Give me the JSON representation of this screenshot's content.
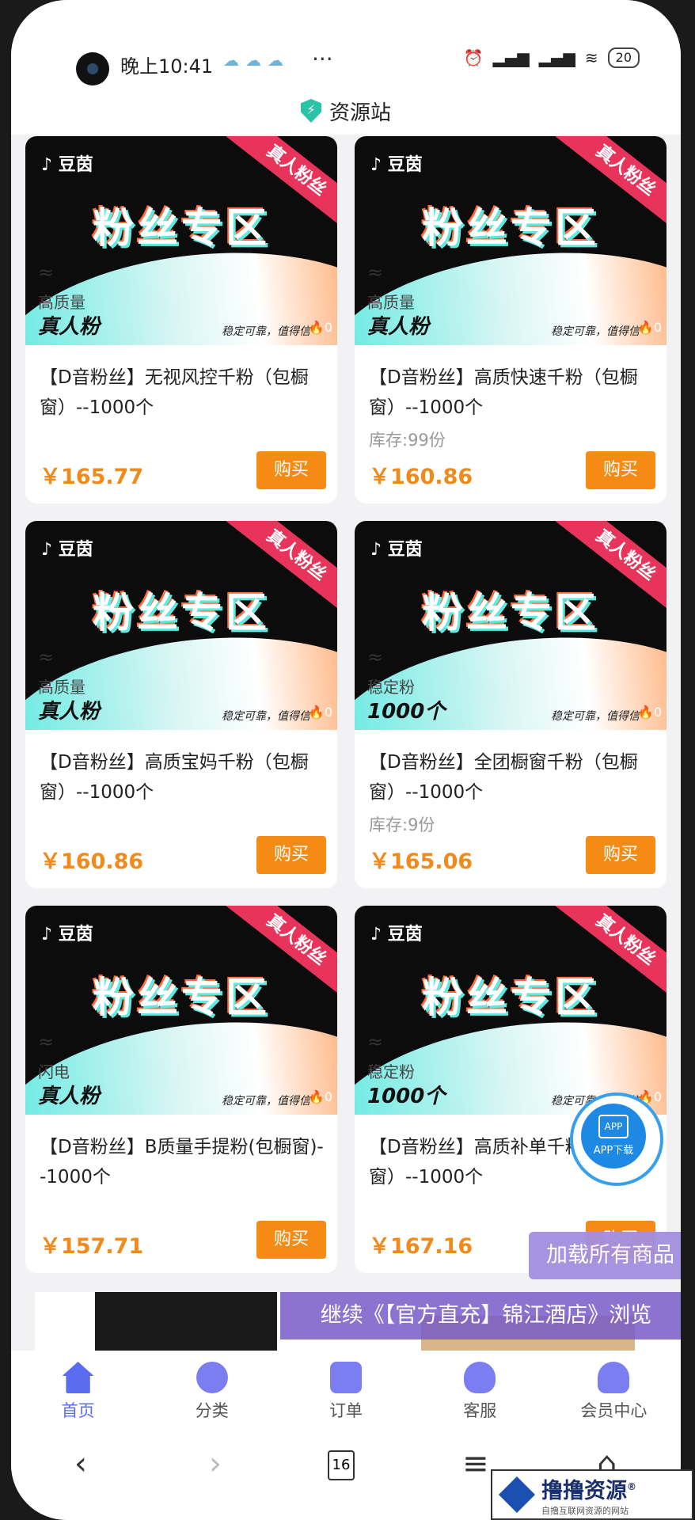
{
  "status_bar": {
    "time": "晚上10:41",
    "dots": "···",
    "battery": "20"
  },
  "header": {
    "title": "资源站",
    "shield_glyph": "⚡"
  },
  "card_common": {
    "brand": "♪ 豆茵",
    "ribbon": "真人粉丝",
    "headline": "粉丝专区",
    "wave_mark": "≈",
    "slogan": "稳定可靠，值得信",
    "fire": "🔥0",
    "buy_label": "购买"
  },
  "products": [
    {
      "subtag": "高质量",
      "main_tag": "真人粉",
      "name": "【D音粉丝】无视风控千粉（包橱窗）--1000个",
      "stock": "",
      "price": "￥165.77"
    },
    {
      "subtag": "高质量",
      "main_tag": "真人粉",
      "name": "【D音粉丝】高质快速千粉（包橱窗）--1000个",
      "stock": "库存:99份",
      "price": "￥160.86"
    },
    {
      "subtag": "高质量",
      "main_tag": "真人粉",
      "name": "【D音粉丝】高质宝妈千粉（包橱窗）--1000个",
      "stock": "",
      "price": "￥160.86"
    },
    {
      "subtag": "稳定粉",
      "main_tag": "1000个",
      "name": "【D音粉丝】全团橱窗千粉（包橱窗）--1000个",
      "stock": "库存:9份",
      "price": "￥165.06"
    },
    {
      "subtag": "闪电",
      "main_tag": "真人粉",
      "name": "【D音粉丝】B质量手提粉(包橱窗)--1000个",
      "stock": "",
      "price": "￥157.71"
    },
    {
      "subtag": "稳定粉",
      "main_tag": "1000个",
      "name": "【D音粉丝】高质补单千粉（包橱窗）--1000个",
      "stock": "",
      "price": "￥167.16"
    }
  ],
  "floating": {
    "app_icon": "APP",
    "app_label": "APP下载",
    "load_all": "加载所有商品",
    "continue": "继续《【官方直充】锦江酒店》浏览"
  },
  "tabs": [
    {
      "label": "首页",
      "icon": "home-icon"
    },
    {
      "label": "分类",
      "icon": "category-icon"
    },
    {
      "label": "订单",
      "icon": "order-icon"
    },
    {
      "label": "客服",
      "icon": "service-icon"
    },
    {
      "label": "会员中心",
      "icon": "member-icon"
    }
  ],
  "browser": {
    "back": "‹",
    "forward": "›",
    "tab_count": "16",
    "menu": "≡",
    "home": "⌂"
  },
  "watermark": {
    "main": "撸撸资源",
    "sub": "自撸互联网资源的网站",
    "reg": "®"
  }
}
